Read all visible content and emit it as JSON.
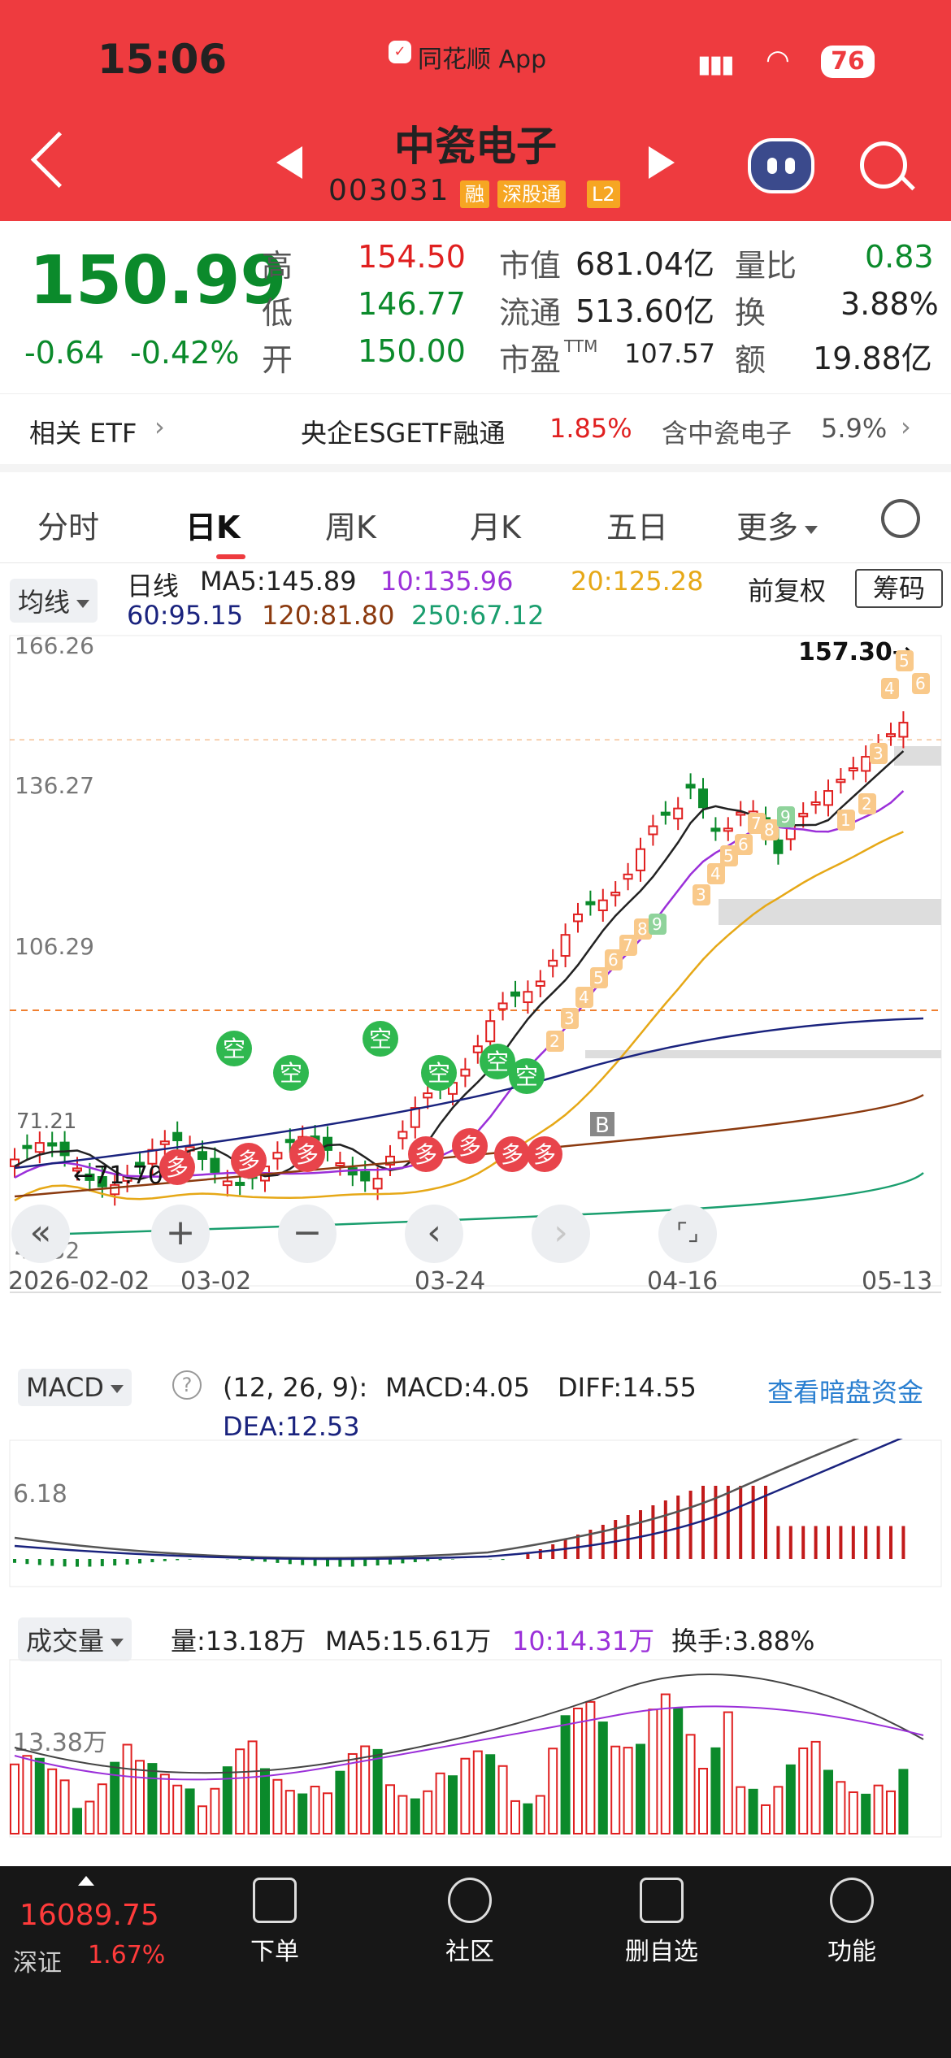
{
  "status_bar": {
    "time": "15:06",
    "app": "同花顺 App",
    "battery": "76"
  },
  "header": {
    "stock_name": "中瓷电子",
    "stock_code": "003031",
    "tags": [
      "融",
      "深股通",
      "L2"
    ]
  },
  "quote": {
    "price": "150.99",
    "change": "-0.64",
    "change_pct": "-0.42%",
    "high_label": "高",
    "high": "154.50",
    "low_label": "低",
    "low": "146.77",
    "open_label": "开",
    "open": "150.00",
    "mktcap_label": "市值",
    "mktcap": "681.04亿",
    "float_label": "流通",
    "float": "513.60亿",
    "pe_label": "市盈",
    "pe_sup": "TTM",
    "pe": "107.57",
    "volratio_label": "量比",
    "volratio": "0.83",
    "turnover_label": "换",
    "turnover": "3.88%",
    "amount_label": "额",
    "amount": "19.88亿"
  },
  "etf": {
    "label": "相关 ETF",
    "name": "央企ESGETF融通",
    "pct": "1.85%",
    "holding": "含中瓷电子",
    "holding_pct": "5.9%"
  },
  "tabs": [
    "分时",
    "日K",
    "周K",
    "月K",
    "五日",
    "更多"
  ],
  "kline": {
    "ma_select": "均线",
    "line_label": "日线",
    "ma5": "MA5:145.89",
    "ma10": "10:135.96",
    "ma20": "20:125.28",
    "ma60": "60:95.15",
    "ma120": "120:81.80",
    "ma250": "250:67.12",
    "adjust": "前复权",
    "chips": "筹码",
    "y_labels": [
      "166.26",
      "136.27",
      "106.29",
      "46.32"
    ],
    "left_price": "71.21",
    "max_label": "157.30→",
    "min_label": "←71.70",
    "x_labels": [
      "2026-02-02",
      "03-02",
      "03-24",
      "04-16",
      "05-13"
    ],
    "signal_kong": "空",
    "signal_duo": "多",
    "signal_b": "B",
    "controls": [
      "«",
      "+",
      "−",
      "‹",
      "›",
      "⌜⌟"
    ]
  },
  "macd": {
    "select": "MACD",
    "params": "(12, 26, 9):",
    "macd": "MACD:4.05",
    "diff": "DIFF:14.55",
    "dea": "DEA:12.53",
    "link": "查看暗盘资金",
    "y_label": "6.18"
  },
  "volume": {
    "select": "成交量",
    "vol": "量:13.18万",
    "ma5": "MA5:15.61万",
    "ma10": "10:14.31万",
    "turnover": "换手:3.88%",
    "y_label": "13.38万"
  },
  "bottom_nav": {
    "index_value": "16089.75",
    "index_name": "深证",
    "index_pct": "1.67%",
    "items": [
      "下单",
      "社区",
      "删自选",
      "功能"
    ]
  },
  "colors": {
    "header": "#ee3b3f",
    "up": "#e02020",
    "down": "#0b8a2b",
    "ma5": "#222222",
    "ma10": "#9b30d9",
    "ma20": "#e6a817",
    "ma60": "#1a237e",
    "ma120": "#8b3a0f",
    "ma250": "#1a9e6e"
  }
}
